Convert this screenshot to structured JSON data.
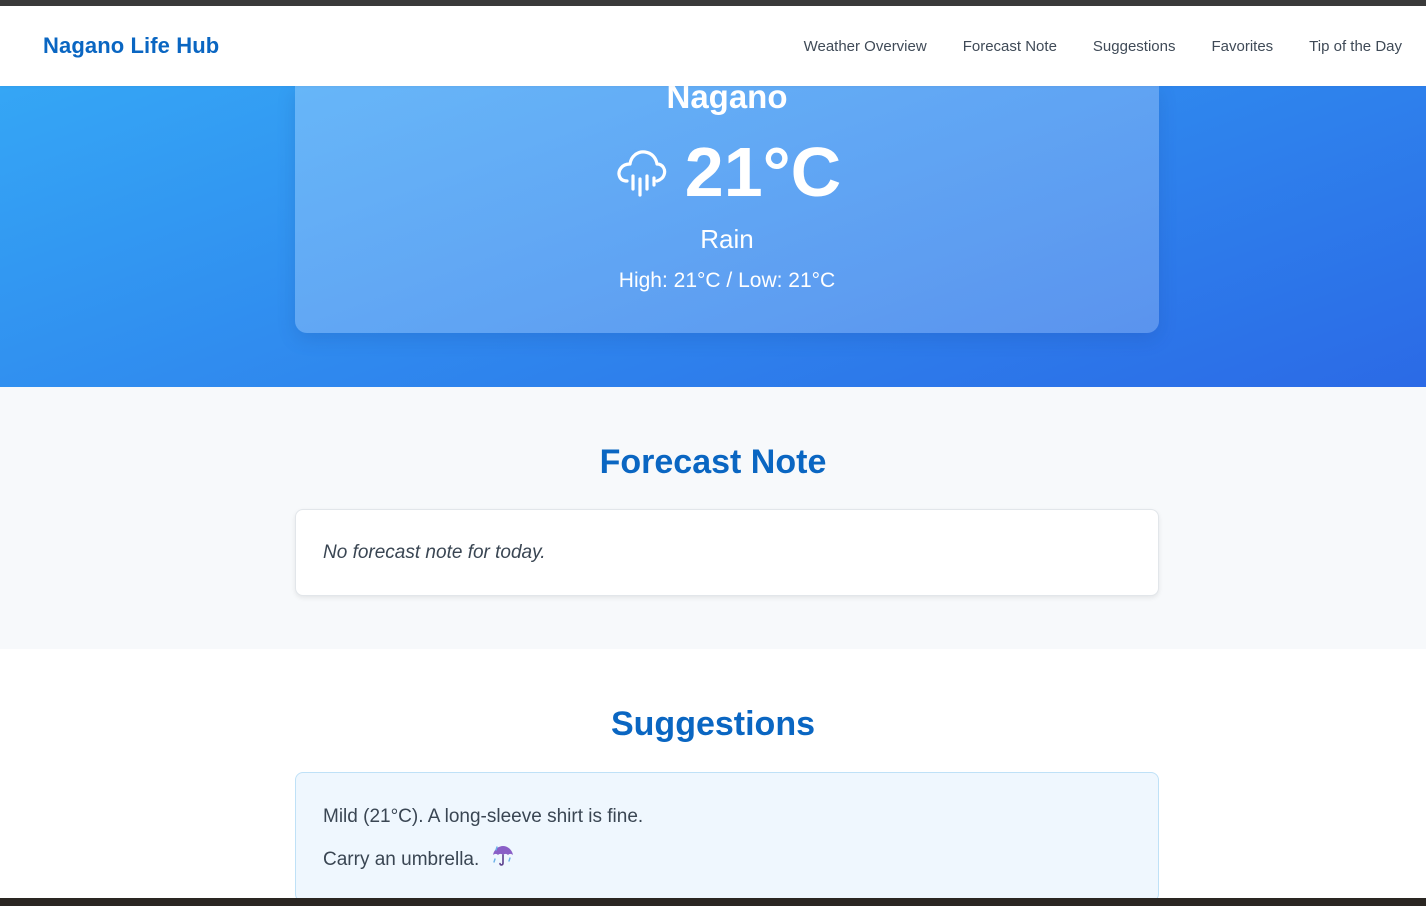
{
  "app": {
    "brand": "Nagano Life Hub"
  },
  "nav": {
    "items": [
      {
        "label": "Weather Overview"
      },
      {
        "label": "Forecast Note"
      },
      {
        "label": "Suggestions"
      },
      {
        "label": "Favorites"
      },
      {
        "label": "Tip of the Day"
      }
    ]
  },
  "weather": {
    "city": "Nagano",
    "icon": "rain-cloud-icon",
    "temperature": "21°C",
    "condition": "Rain",
    "high_low": "High: 21°C / Low: 21°C"
  },
  "forecast": {
    "title": "Forecast Note",
    "note": "No forecast note for today."
  },
  "suggestions": {
    "title": "Suggestions",
    "items": [
      {
        "text": "Mild (21°C). A long-sleeve shirt is fine.",
        "icon": null
      },
      {
        "text": "Carry an umbrella.",
        "icon": "umbrella-icon"
      }
    ]
  },
  "colors": {
    "brand": "#0a66c2",
    "hero_start": "#35a6f5",
    "hero_end": "#2b6ae6"
  }
}
